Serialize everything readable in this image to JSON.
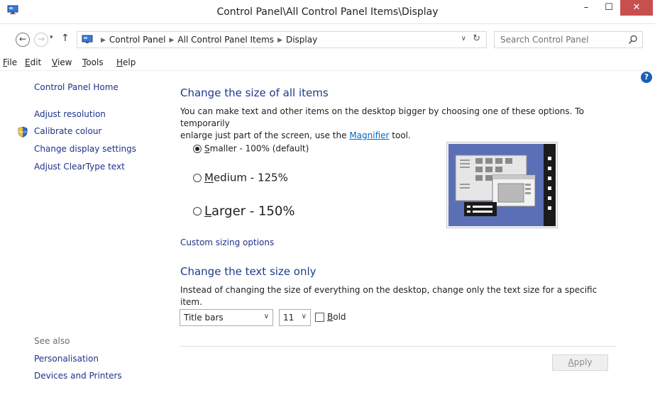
{
  "window": {
    "title": "Control Panel\\All Control Panel Items\\Display",
    "minimize": "–",
    "maximize": "☐",
    "close": "✕"
  },
  "address": {
    "crumbs": [
      "Control Panel",
      "All Control Panel Items",
      "Display"
    ],
    "back": "←",
    "forward": "→",
    "recent": "▾",
    "up": "↑",
    "dropdown": "∨",
    "refresh": "↻"
  },
  "search": {
    "placeholder": "Search Control Panel"
  },
  "menu": {
    "file": {
      "u": "F",
      "rest": "ile"
    },
    "edit": {
      "u": "E",
      "rest": "dit"
    },
    "view": {
      "u": "V",
      "rest": "iew"
    },
    "tools": {
      "u": "T",
      "rest": "ools"
    },
    "help": {
      "u": "H",
      "rest": "elp"
    }
  },
  "help_glyph": "?",
  "sidebar": {
    "home": "Control Panel Home",
    "items": [
      "Adjust resolution",
      "Calibrate colour",
      "Change display settings",
      "Adjust ClearType text"
    ],
    "see_also_title": "See also",
    "see_also": [
      "Personalisation",
      "Devices and Printers"
    ]
  },
  "size_section": {
    "title": "Change the size of all items",
    "desc_before": "You can make text and other items on the desktop bigger by choosing one of these options. To temporarily",
    "desc_line2_before": "enlarge just part of the screen, use the ",
    "desc_link": "Magnifier",
    "desc_after": " tool.",
    "options": [
      {
        "u": "S",
        "rest": "maller - 100% (default)",
        "checked": true
      },
      {
        "u": "M",
        "rest": "edium - 125%",
        "checked": false
      },
      {
        "u": "L",
        "rest": "arger - 150%",
        "checked": false
      }
    ],
    "custom_link": "Custom sizing options"
  },
  "text_section": {
    "title": "Change the text size only",
    "desc": "Instead of changing the size of everything on the desktop, change only the text size for a specific item.",
    "item_select": "Title bars",
    "size_select": "11",
    "chevron": "∨",
    "bold": {
      "u": "B",
      "rest": "old",
      "checked": false
    }
  },
  "apply": {
    "u": "A",
    "rest": "pply"
  },
  "colors": {
    "accent": "#1e3a8a",
    "link": "#1e3287",
    "close": "#c7504f"
  }
}
